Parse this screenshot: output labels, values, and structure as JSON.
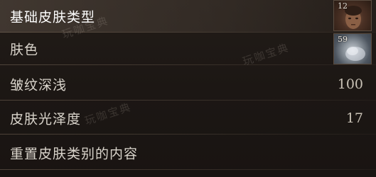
{
  "rows": [
    {
      "label": "基础皮肤类型",
      "thumb_number": "12"
    },
    {
      "label": "肤色",
      "thumb_number": "59"
    },
    {
      "label": "皱纹深浅",
      "value": "100"
    },
    {
      "label": "皮肤光泽度",
      "value": "17"
    },
    {
      "label": "重置皮肤类别的内容"
    }
  ],
  "watermark": "玩咖宝典"
}
